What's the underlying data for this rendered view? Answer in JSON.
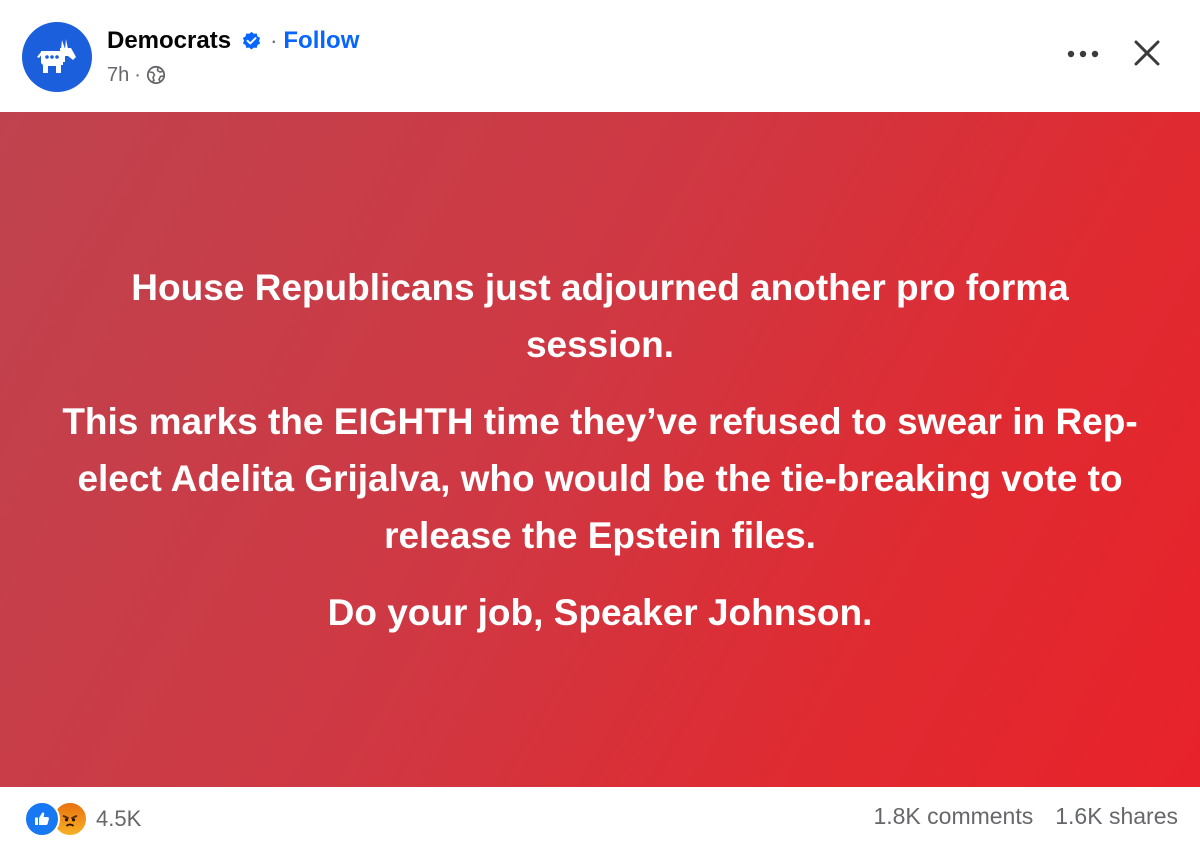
{
  "post": {
    "author": "Democrats",
    "follow_label": "Follow",
    "timestamp": "7h",
    "body": {
      "paragraph_1": "House Republicans just adjourned another pro forma session.",
      "paragraph_2": "This marks the EIGHTH time they’ve refused to swear in Rep-elect Adelita Grijalva, who would be the tie-breaking vote to release the Epstein files.",
      "paragraph_3": "Do your job, Speaker Johnson."
    },
    "background_colors": [
      "#bf434e",
      "#e8222a"
    ],
    "reactions": {
      "icons": [
        "like-icon",
        "angry-icon"
      ],
      "count": "4.5K"
    },
    "comments": "1.8K comments",
    "shares": "1.6K shares"
  },
  "icons": {
    "avatar": "donkey-logo-icon",
    "verified": "verified-badge-icon",
    "audience": "globe-icon",
    "more": "more-horizontal-icon",
    "close": "close-icon"
  },
  "colors": {
    "brand_blue": "#1c5fdc",
    "link_blue": "#0866ff",
    "muted_text": "#65676b"
  }
}
